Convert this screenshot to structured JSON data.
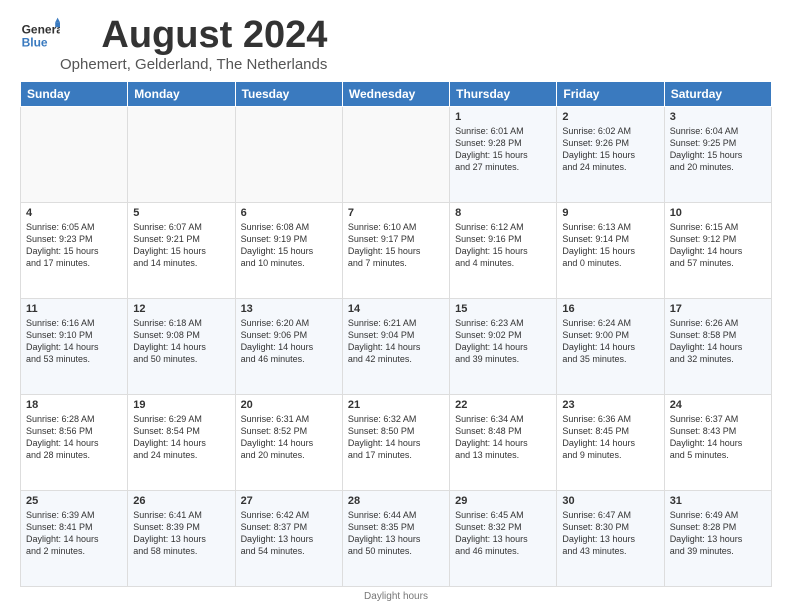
{
  "header": {
    "logo_general": "General",
    "logo_blue": "Blue",
    "month_title": "August 2024",
    "subtitle": "Ophemert, Gelderland, The Netherlands"
  },
  "days_of_week": [
    "Sunday",
    "Monday",
    "Tuesday",
    "Wednesday",
    "Thursday",
    "Friday",
    "Saturday"
  ],
  "footer": "Daylight hours",
  "weeks": [
    [
      {
        "day": "",
        "info": ""
      },
      {
        "day": "",
        "info": ""
      },
      {
        "day": "",
        "info": ""
      },
      {
        "day": "",
        "info": ""
      },
      {
        "day": "1",
        "info": "Sunrise: 6:01 AM\nSunset: 9:28 PM\nDaylight: 15 hours\nand 27 minutes."
      },
      {
        "day": "2",
        "info": "Sunrise: 6:02 AM\nSunset: 9:26 PM\nDaylight: 15 hours\nand 24 minutes."
      },
      {
        "day": "3",
        "info": "Sunrise: 6:04 AM\nSunset: 9:25 PM\nDaylight: 15 hours\nand 20 minutes."
      }
    ],
    [
      {
        "day": "4",
        "info": "Sunrise: 6:05 AM\nSunset: 9:23 PM\nDaylight: 15 hours\nand 17 minutes."
      },
      {
        "day": "5",
        "info": "Sunrise: 6:07 AM\nSunset: 9:21 PM\nDaylight: 15 hours\nand 14 minutes."
      },
      {
        "day": "6",
        "info": "Sunrise: 6:08 AM\nSunset: 9:19 PM\nDaylight: 15 hours\nand 10 minutes."
      },
      {
        "day": "7",
        "info": "Sunrise: 6:10 AM\nSunset: 9:17 PM\nDaylight: 15 hours\nand 7 minutes."
      },
      {
        "day": "8",
        "info": "Sunrise: 6:12 AM\nSunset: 9:16 PM\nDaylight: 15 hours\nand 4 minutes."
      },
      {
        "day": "9",
        "info": "Sunrise: 6:13 AM\nSunset: 9:14 PM\nDaylight: 15 hours\nand 0 minutes."
      },
      {
        "day": "10",
        "info": "Sunrise: 6:15 AM\nSunset: 9:12 PM\nDaylight: 14 hours\nand 57 minutes."
      }
    ],
    [
      {
        "day": "11",
        "info": "Sunrise: 6:16 AM\nSunset: 9:10 PM\nDaylight: 14 hours\nand 53 minutes."
      },
      {
        "day": "12",
        "info": "Sunrise: 6:18 AM\nSunset: 9:08 PM\nDaylight: 14 hours\nand 50 minutes."
      },
      {
        "day": "13",
        "info": "Sunrise: 6:20 AM\nSunset: 9:06 PM\nDaylight: 14 hours\nand 46 minutes."
      },
      {
        "day": "14",
        "info": "Sunrise: 6:21 AM\nSunset: 9:04 PM\nDaylight: 14 hours\nand 42 minutes."
      },
      {
        "day": "15",
        "info": "Sunrise: 6:23 AM\nSunset: 9:02 PM\nDaylight: 14 hours\nand 39 minutes."
      },
      {
        "day": "16",
        "info": "Sunrise: 6:24 AM\nSunset: 9:00 PM\nDaylight: 14 hours\nand 35 minutes."
      },
      {
        "day": "17",
        "info": "Sunrise: 6:26 AM\nSunset: 8:58 PM\nDaylight: 14 hours\nand 32 minutes."
      }
    ],
    [
      {
        "day": "18",
        "info": "Sunrise: 6:28 AM\nSunset: 8:56 PM\nDaylight: 14 hours\nand 28 minutes."
      },
      {
        "day": "19",
        "info": "Sunrise: 6:29 AM\nSunset: 8:54 PM\nDaylight: 14 hours\nand 24 minutes."
      },
      {
        "day": "20",
        "info": "Sunrise: 6:31 AM\nSunset: 8:52 PM\nDaylight: 14 hours\nand 20 minutes."
      },
      {
        "day": "21",
        "info": "Sunrise: 6:32 AM\nSunset: 8:50 PM\nDaylight: 14 hours\nand 17 minutes."
      },
      {
        "day": "22",
        "info": "Sunrise: 6:34 AM\nSunset: 8:48 PM\nDaylight: 14 hours\nand 13 minutes."
      },
      {
        "day": "23",
        "info": "Sunrise: 6:36 AM\nSunset: 8:45 PM\nDaylight: 14 hours\nand 9 minutes."
      },
      {
        "day": "24",
        "info": "Sunrise: 6:37 AM\nSunset: 8:43 PM\nDaylight: 14 hours\nand 5 minutes."
      }
    ],
    [
      {
        "day": "25",
        "info": "Sunrise: 6:39 AM\nSunset: 8:41 PM\nDaylight: 14 hours\nand 2 minutes."
      },
      {
        "day": "26",
        "info": "Sunrise: 6:41 AM\nSunset: 8:39 PM\nDaylight: 13 hours\nand 58 minutes."
      },
      {
        "day": "27",
        "info": "Sunrise: 6:42 AM\nSunset: 8:37 PM\nDaylight: 13 hours\nand 54 minutes."
      },
      {
        "day": "28",
        "info": "Sunrise: 6:44 AM\nSunset: 8:35 PM\nDaylight: 13 hours\nand 50 minutes."
      },
      {
        "day": "29",
        "info": "Sunrise: 6:45 AM\nSunset: 8:32 PM\nDaylight: 13 hours\nand 46 minutes."
      },
      {
        "day": "30",
        "info": "Sunrise: 6:47 AM\nSunset: 8:30 PM\nDaylight: 13 hours\nand 43 minutes."
      },
      {
        "day": "31",
        "info": "Sunrise: 6:49 AM\nSunset: 8:28 PM\nDaylight: 13 hours\nand 39 minutes."
      }
    ]
  ]
}
